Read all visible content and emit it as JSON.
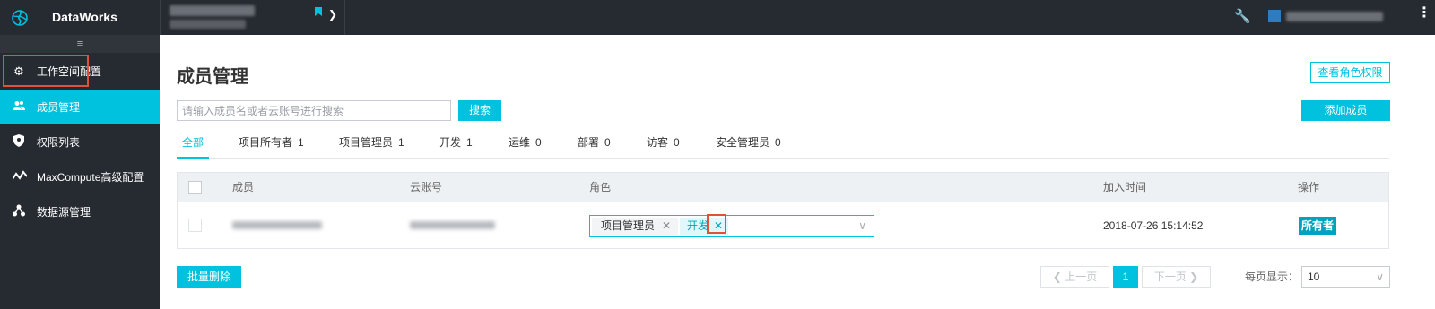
{
  "app": {
    "title": "DataWorks"
  },
  "sidebar": {
    "collapse_glyph": "≡",
    "items": [
      {
        "label": "工作空间配置",
        "icon": "gear-icon",
        "active": false
      },
      {
        "label": "成员管理",
        "icon": "users-icon",
        "active": true
      },
      {
        "label": "权限列表",
        "icon": "shield-icon",
        "active": false
      },
      {
        "label": "MaxCompute高级配置",
        "icon": "pulse-icon",
        "active": false
      },
      {
        "label": "数据源管理",
        "icon": "datasource-icon",
        "active": false
      }
    ]
  },
  "main": {
    "title": "成员管理",
    "view_role_permissions": "查看角色权限",
    "search_placeholder": "请输入成员名或者云账号进行搜索",
    "search_button": "搜索",
    "add_member_button": "添加成员",
    "tabs": [
      {
        "label": "全部",
        "count": ""
      },
      {
        "label": "项目所有者",
        "count": "1"
      },
      {
        "label": "项目管理员",
        "count": "1"
      },
      {
        "label": "开发",
        "count": "1"
      },
      {
        "label": "运维",
        "count": "0"
      },
      {
        "label": "部署",
        "count": "0"
      },
      {
        "label": "访客",
        "count": "0"
      },
      {
        "label": "安全管理员",
        "count": "0"
      }
    ],
    "table": {
      "headers": {
        "member": "成员",
        "account": "云账号",
        "role": "角色",
        "join_time": "加入时间",
        "actions": "操作"
      },
      "rows": [
        {
          "roles": [
            "项目管理员",
            "开发"
          ],
          "join_time": "2018-07-26 15:14:52",
          "action": "所有者"
        }
      ]
    },
    "batch_delete": "批量删除",
    "pagination": {
      "prev": "上一页",
      "next": "下一页",
      "current": "1",
      "per_page_label": "每页显示：",
      "per_page_value": "10"
    }
  },
  "colors": {
    "accent": "#00c1de",
    "topbar": "#262a31",
    "highlight_box": "#e0513b"
  }
}
